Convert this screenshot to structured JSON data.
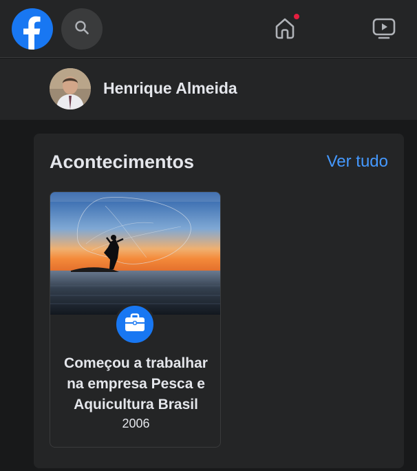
{
  "header": {
    "logo_icon": "facebook-logo-icon",
    "search_icon": "search-icon",
    "home_icon": "home-icon",
    "watch_icon": "video-icon",
    "brand_color": "#1877f2",
    "notification_color": "#e41e3f"
  },
  "profile": {
    "name": "Henrique Almeida"
  },
  "life_events": {
    "title": "Acontecimentos",
    "see_all_label": "Ver tudo",
    "items": [
      {
        "icon": "briefcase-icon",
        "description": "Começou a trabalhar na empresa Pesca e Aquicultura Brasil",
        "year": "2006"
      }
    ]
  }
}
